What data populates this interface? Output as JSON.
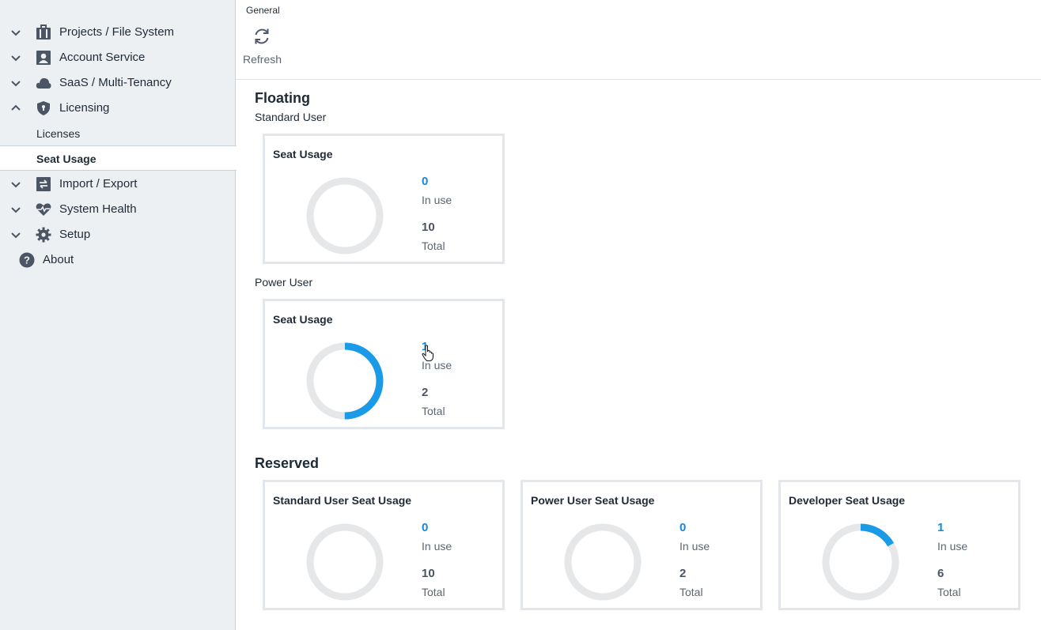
{
  "sidebar": {
    "items": [
      {
        "label": "Projects / File System",
        "expanded": false,
        "icon": "briefcase-icon"
      },
      {
        "label": "Account Service",
        "expanded": false,
        "icon": "user-card-icon"
      },
      {
        "label": "SaaS / Multi-Tenancy",
        "expanded": false,
        "icon": "cloud-icon"
      },
      {
        "label": "Licensing",
        "expanded": true,
        "icon": "shield-icon"
      },
      {
        "label": "Import / Export",
        "expanded": false,
        "icon": "transfer-icon"
      },
      {
        "label": "System Health",
        "expanded": false,
        "icon": "heart-pulse-icon"
      },
      {
        "label": "Setup",
        "expanded": false,
        "icon": "gear-icon"
      },
      {
        "label": "About",
        "icon": "help-icon"
      }
    ],
    "licensing_children": [
      {
        "label": "Licenses",
        "active": false
      },
      {
        "label": "Seat Usage",
        "active": true
      }
    ]
  },
  "toolbar": {
    "group_label": "General",
    "refresh_label": "Refresh"
  },
  "floating": {
    "title": "Floating",
    "standard": {
      "subtitle": "Standard User",
      "card_title": "Seat Usage",
      "in_use": "0",
      "in_use_label": "In use",
      "total": "10",
      "total_label": "Total",
      "fraction": 0
    },
    "power": {
      "subtitle": "Power User",
      "card_title": "Seat Usage",
      "in_use": "1",
      "in_use_label": "In use",
      "total": "2",
      "total_label": "Total",
      "fraction": 0.5
    }
  },
  "reserved": {
    "title": "Reserved",
    "cards": [
      {
        "card_title": "Standard User Seat Usage",
        "in_use": "0",
        "in_use_label": "In use",
        "total": "10",
        "total_label": "Total",
        "fraction": 0
      },
      {
        "card_title": "Power User Seat Usage",
        "in_use": "0",
        "in_use_label": "In use",
        "total": "2",
        "total_label": "Total",
        "fraction": 0
      },
      {
        "card_title": "Developer Seat Usage",
        "in_use": "1",
        "in_use_label": "In use",
        "total": "6",
        "total_label": "Total",
        "fraction": 0.1667
      }
    ]
  },
  "colors": {
    "accent": "#1b9ae8",
    "track": "#e6e7e9",
    "in_use_text": "#1787d6"
  }
}
